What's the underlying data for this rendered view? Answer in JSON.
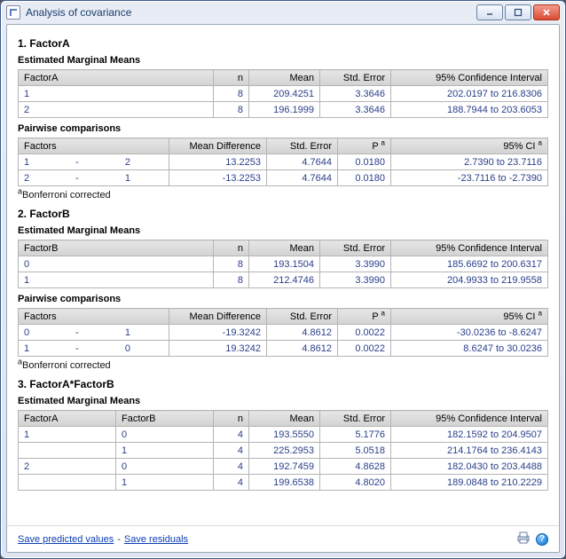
{
  "window": {
    "title": "Analysis of covariance"
  },
  "sections": [
    {
      "heading": "1. FactorA",
      "emm": {
        "title": "Estimated Marginal Means",
        "cols": {
          "factor": "FactorA",
          "n": "n",
          "mean": "Mean",
          "se": "Std. Error",
          "ci": "95% Confidence Interval"
        },
        "w": {
          "factor": "220px",
          "n": "40px",
          "mean": "80px",
          "se": "80px",
          "ci": ""
        },
        "rows": [
          {
            "level": "1",
            "n": "8",
            "mean": "209.4251",
            "se": "3.3646",
            "ci": "202.0197 to 216.8306"
          },
          {
            "level": "2",
            "n": "8",
            "mean": "196.1999",
            "se": "3.3646",
            "ci": "188.7944 to 203.6053"
          }
        ]
      },
      "pair": {
        "title": "Pairwise comparisons",
        "cols": {
          "factors": "Factors",
          "diff": "Mean Difference",
          "se": "Std. Error",
          "p": "P",
          "ci": "95% CI"
        },
        "sup": "a",
        "w": {
          "factors": "170px",
          "diff": "110px",
          "se": "80px",
          "p": "60px",
          "ci": ""
        },
        "rows": [
          {
            "a": "1",
            "b": "2",
            "diff": "13.2253",
            "se": "4.7644",
            "p": "0.0180",
            "ci": "2.7390 to 23.7116"
          },
          {
            "a": "2",
            "b": "1",
            "diff": "-13.2253",
            "se": "4.7644",
            "p": "0.0180",
            "ci": "-23.7116 to -2.7390"
          }
        ],
        "footnote": "Bonferroni corrected",
        "footnote_sup": "a"
      }
    },
    {
      "heading": "2. FactorB",
      "emm": {
        "title": "Estimated Marginal Means",
        "cols": {
          "factor": "FactorB",
          "n": "n",
          "mean": "Mean",
          "se": "Std. Error",
          "ci": "95% Confidence Interval"
        },
        "w": {
          "factor": "220px",
          "n": "40px",
          "mean": "80px",
          "se": "80px",
          "ci": ""
        },
        "rows": [
          {
            "level": "0",
            "n": "8",
            "mean": "193.1504",
            "se": "3.3990",
            "ci": "185.6692 to 200.6317"
          },
          {
            "level": "1",
            "n": "8",
            "mean": "212.4746",
            "se": "3.3990",
            "ci": "204.9933 to 219.9558"
          }
        ]
      },
      "pair": {
        "title": "Pairwise comparisons",
        "cols": {
          "factors": "Factors",
          "diff": "Mean Difference",
          "se": "Std. Error",
          "p": "P",
          "ci": "95% CI"
        },
        "sup": "a",
        "w": {
          "factors": "170px",
          "diff": "110px",
          "se": "80px",
          "p": "60px",
          "ci": ""
        },
        "rows": [
          {
            "a": "0",
            "b": "1",
            "diff": "-19.3242",
            "se": "4.8612",
            "p": "0.0022",
            "ci": "-30.0236 to -8.6247"
          },
          {
            "a": "1",
            "b": "0",
            "diff": "19.3242",
            "se": "4.8612",
            "p": "0.0022",
            "ci": "8.6247 to 30.0236"
          }
        ],
        "footnote": "Bonferroni corrected",
        "footnote_sup": "a"
      }
    },
    {
      "heading": "3. FactorA*FactorB",
      "emm2": {
        "title": "Estimated Marginal Means",
        "cols": {
          "fa": "FactorA",
          "fb": "FactorB",
          "n": "n",
          "mean": "Mean",
          "se": "Std. Error",
          "ci": "95% Confidence Interval"
        },
        "w": {
          "fa": "110px",
          "fb": "110px",
          "n": "40px",
          "mean": "80px",
          "se": "80px",
          "ci": ""
        },
        "rows": [
          {
            "fa": "1",
            "fb": "0",
            "n": "4",
            "mean": "193.5550",
            "se": "5.1776",
            "ci": "182.1592 to 204.9507"
          },
          {
            "fa": "",
            "fb": "1",
            "n": "4",
            "mean": "225.2953",
            "se": "5.0518",
            "ci": "214.1764 to 236.4143"
          },
          {
            "fa": "2",
            "fb": "0",
            "n": "4",
            "mean": "192.7459",
            "se": "4.8628",
            "ci": "182.0430 to 203.4488"
          },
          {
            "fa": "",
            "fb": "1",
            "n": "4",
            "mean": "199.6538",
            "se": "4.8020",
            "ci": "189.0848 to 210.2229"
          }
        ]
      }
    }
  ],
  "footer": {
    "save_predicted": "Save predicted values",
    "save_residuals": "Save residuals",
    "sep": " - "
  }
}
